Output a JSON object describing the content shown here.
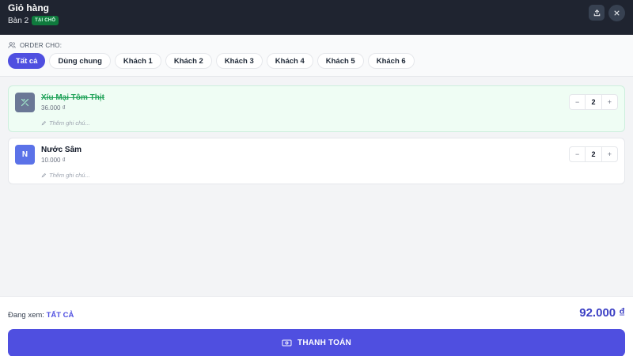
{
  "header": {
    "title": "Giỏ hàng",
    "table": "Bàn 2",
    "badge": "TẠI CHỖ"
  },
  "order_for": {
    "label": "ORDER CHO:",
    "chips": [
      {
        "label": "Tất cả",
        "active": true
      },
      {
        "label": "Dùng chung"
      },
      {
        "label": "Khách 1"
      },
      {
        "label": "Khách 2"
      },
      {
        "label": "Khách 3"
      },
      {
        "label": "Khách 4"
      },
      {
        "label": "Khách 5"
      },
      {
        "label": "Khách 6"
      }
    ]
  },
  "items": [
    {
      "name": "Xíu Mại Tôm Thịt",
      "price": "36.000 ₫",
      "note_placeholder": "Thêm ghi chú...",
      "qty": "2",
      "minus": "−",
      "plus": "+",
      "status": "done",
      "thumb_icon": "utensils-icon"
    },
    {
      "name": "Nước Sâm",
      "price": "10.000 ₫",
      "note_placeholder": "Thêm ghi chú...",
      "qty": "2",
      "minus": "−",
      "plus": "+",
      "thumb_letter": "N"
    }
  ],
  "footer": {
    "viewing_label": "Đang xem:",
    "viewing_value": "TẤT CẢ",
    "total": "92.000 ₫",
    "pay_label": "THANH TOÁN"
  },
  "colors": {
    "accent": "#4f4fe0",
    "header_bg": "#1f2430",
    "done_green": "#22a35a"
  }
}
